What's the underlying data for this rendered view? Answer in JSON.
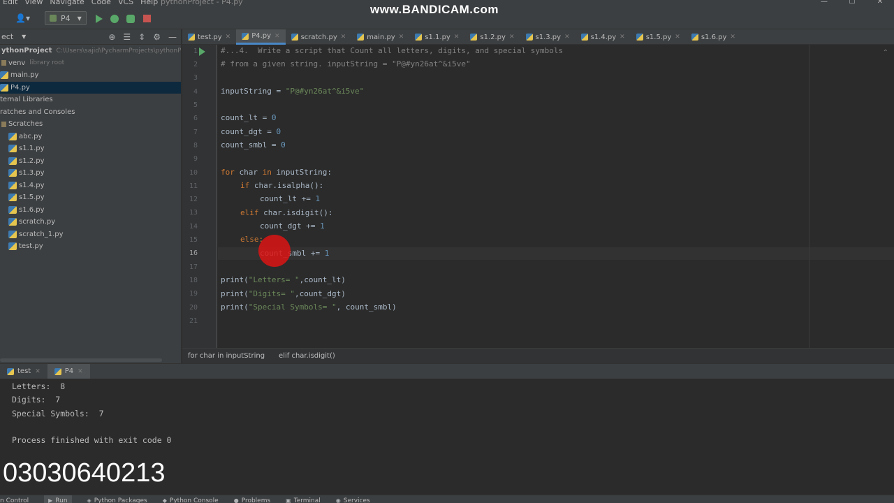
{
  "window": {
    "title": "pythonProject - P4.py",
    "watermark": "www.BANDICAM.com"
  },
  "menu": [
    "Edit",
    "View",
    "Navigate",
    "Code",
    "VCS",
    "Help"
  ],
  "toolbar": {
    "run_config": "P4"
  },
  "project_panel": {
    "header": "ect",
    "root": {
      "name": "ythonProject",
      "path": "C:\\Users\\sajid\\PycharmProjects\\pythonP"
    },
    "items": [
      {
        "label": "venv",
        "note": "library root"
      },
      {
        "label": "main.py"
      },
      {
        "label": "P4.py"
      },
      {
        "label": "ternal Libraries"
      },
      {
        "label": "ratches and Consoles"
      },
      {
        "label": "Scratches"
      },
      {
        "label": "abc.py"
      },
      {
        "label": "s1.1.py"
      },
      {
        "label": "s1.2.py"
      },
      {
        "label": "s1.3.py"
      },
      {
        "label": "s1.4.py"
      },
      {
        "label": "s1.5.py"
      },
      {
        "label": "s1.6.py"
      },
      {
        "label": "scratch.py"
      },
      {
        "label": "scratch_1.py"
      },
      {
        "label": "test.py"
      }
    ]
  },
  "editor_tabs": [
    "test.py",
    "P4.py",
    "scratch.py",
    "main.py",
    "s1.1.py",
    "s1.2.py",
    "s1.3.py",
    "s1.4.py",
    "s1.5.py",
    "s1.6.py"
  ],
  "active_tab": "P4.py",
  "code": {
    "line_numbers": [
      "1",
      "2",
      "3",
      "4",
      "5",
      "6",
      "7",
      "8",
      "9",
      "10",
      "11",
      "12",
      "13",
      "14",
      "15",
      "16",
      "17",
      "18",
      "19",
      "20",
      "21"
    ],
    "comment1": "#...4.  Write a script that Count all letters, digits, and special symbols",
    "comment2": "# from a given string. inputString = \"P@#yn26at^&i5ve\"",
    "input_var": "inputString = ",
    "input_val": "\"P@#yn26at^&i5ve\"",
    "lt_var": "count_lt = ",
    "dgt_var": "count_dgt = ",
    "smbl_var": "count_smbl = ",
    "zero": "0",
    "one": "1",
    "kw_for": "for",
    "kw_in": "in",
    "for_rest_a": " char ",
    "for_rest_b": " inputString:",
    "kw_if": "if",
    "if_rest": " char.isalpha():",
    "lt_inc": "count_lt += ",
    "kw_elif": "elif",
    "elif_rest": " char.isdigit():",
    "dgt_inc": "count_dgt += ",
    "kw_else": "else:",
    "smbl_inc": "count_smbl += ",
    "print": "print(",
    "p1_str": "\"Letters= \"",
    "p1_rest": ",count_lt)",
    "p2_str": "\"Digits= \"",
    "p2_rest": ",count_dgt)",
    "p3_str": "\"Special Symbols= \"",
    "p3_rest": ", count_smbl)"
  },
  "breadcrumbs": [
    "for char in inputString",
    "elif char.isdigit()"
  ],
  "run_panel": {
    "tabs": [
      "test",
      "P4"
    ],
    "output": [
      "Letters:  8",
      "Digits:  7",
      "Special Symbols:  7",
      "",
      "Process finished with exit code 0"
    ]
  },
  "overlay_number": "03030640213",
  "bottom_bar": [
    "n Control",
    "Run",
    "Python Packages",
    "Python Console",
    "Problems",
    "Terminal",
    "Services"
  ]
}
